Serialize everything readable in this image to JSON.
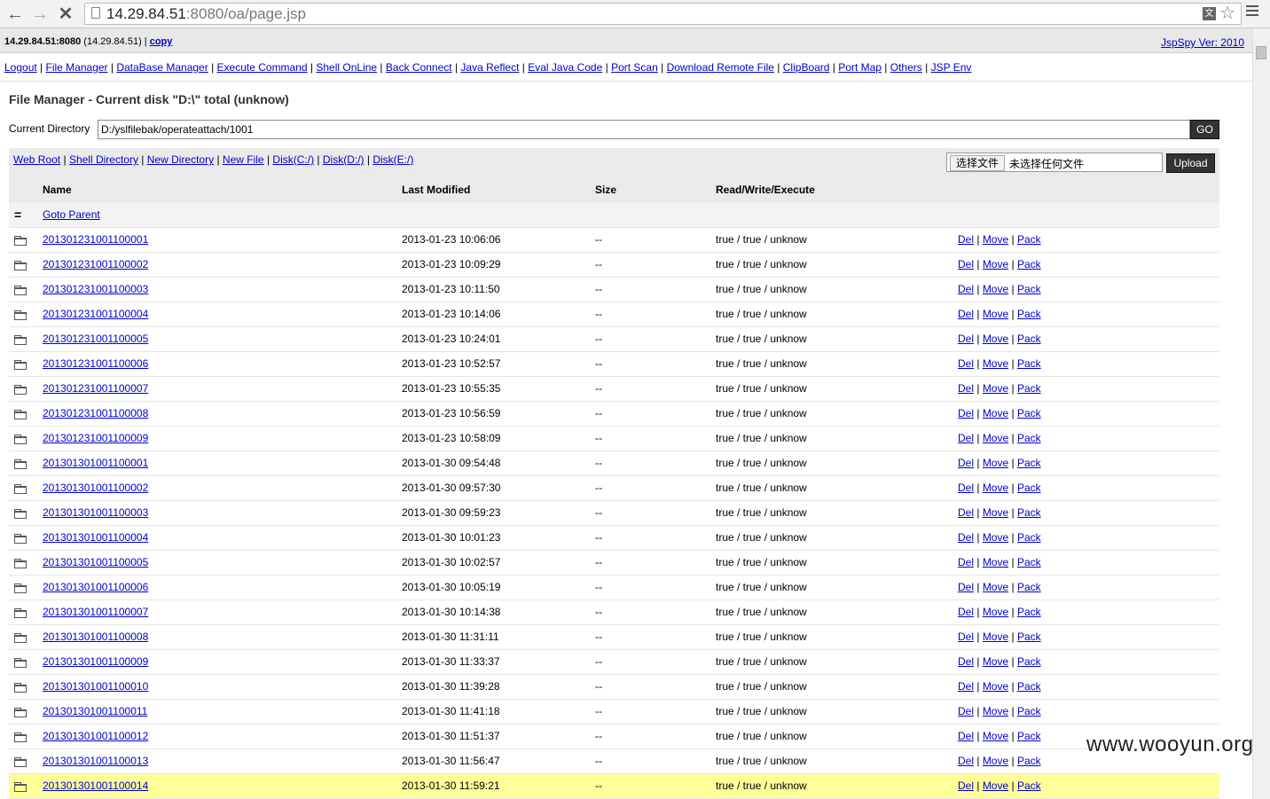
{
  "browser": {
    "url_host": "14.29.84.51",
    "url_rest": ":8080/oa/page.jsp"
  },
  "info": {
    "host_bold": "14.29.84.51:8080",
    "host_ip": " (14.29.84.51) | ",
    "copy_label": "copy",
    "version": "JspSpy Ver: 2010"
  },
  "nav": {
    "items": [
      "Logout",
      "File Manager",
      "DataBase Manager",
      "Execute Command",
      "Shell OnLine",
      "Back Connect",
      "Java Reflect",
      "Eval Java Code",
      "Port Scan",
      "Download Remote File",
      "ClipBoard",
      "Port Map",
      "Others",
      "JSP Env"
    ]
  },
  "fm": {
    "title": "File Manager - Current disk \"D:\\\" total (unknow)",
    "dir_label": "Current Directory",
    "dir_value": "D:/yslfilebak/operateattach/1001",
    "go_label": "GO"
  },
  "toolbar": {
    "links": [
      "Web Root",
      "Shell Directory",
      "New Directory",
      "New File",
      "Disk(C:/)",
      "Disk(D:/)",
      "Disk(E:/)"
    ],
    "choose_file": "选择文件",
    "no_file": "未选择任何文件",
    "upload_label": "Upload"
  },
  "table": {
    "headers": {
      "name": "Name",
      "modified": "Last Modified",
      "size": "Size",
      "rwx": "Read/Write/Execute"
    },
    "parent_label": "Goto Parent",
    "parent_icon": "=",
    "actions": [
      "Del",
      "Move",
      "Pack"
    ],
    "rows": [
      {
        "name": "201301231001100001",
        "modified": "2013-01-23 10:06:06",
        "size": "--",
        "rwx": "true / true / unknow"
      },
      {
        "name": "201301231001100002",
        "modified": "2013-01-23 10:09:29",
        "size": "--",
        "rwx": "true / true / unknow"
      },
      {
        "name": "201301231001100003",
        "modified": "2013-01-23 10:11:50",
        "size": "--",
        "rwx": "true / true / unknow"
      },
      {
        "name": "201301231001100004",
        "modified": "2013-01-23 10:14:06",
        "size": "--",
        "rwx": "true / true / unknow"
      },
      {
        "name": "201301231001100005",
        "modified": "2013-01-23 10:24:01",
        "size": "--",
        "rwx": "true / true / unknow"
      },
      {
        "name": "201301231001100006",
        "modified": "2013-01-23 10:52:57",
        "size": "--",
        "rwx": "true / true / unknow"
      },
      {
        "name": "201301231001100007",
        "modified": "2013-01-23 10:55:35",
        "size": "--",
        "rwx": "true / true / unknow"
      },
      {
        "name": "201301231001100008",
        "modified": "2013-01-23 10:56:59",
        "size": "--",
        "rwx": "true / true / unknow"
      },
      {
        "name": "201301231001100009",
        "modified": "2013-01-23 10:58:09",
        "size": "--",
        "rwx": "true / true / unknow"
      },
      {
        "name": "201301301001100001",
        "modified": "2013-01-30 09:54:48",
        "size": "--",
        "rwx": "true / true / unknow"
      },
      {
        "name": "201301301001100002",
        "modified": "2013-01-30 09:57:30",
        "size": "--",
        "rwx": "true / true / unknow"
      },
      {
        "name": "201301301001100003",
        "modified": "2013-01-30 09:59:23",
        "size": "--",
        "rwx": "true / true / unknow"
      },
      {
        "name": "201301301001100004",
        "modified": "2013-01-30 10:01:23",
        "size": "--",
        "rwx": "true / true / unknow"
      },
      {
        "name": "201301301001100005",
        "modified": "2013-01-30 10:02:57",
        "size": "--",
        "rwx": "true / true / unknow"
      },
      {
        "name": "201301301001100006",
        "modified": "2013-01-30 10:05:19",
        "size": "--",
        "rwx": "true / true / unknow"
      },
      {
        "name": "201301301001100007",
        "modified": "2013-01-30 10:14:38",
        "size": "--",
        "rwx": "true / true / unknow"
      },
      {
        "name": "201301301001100008",
        "modified": "2013-01-30 11:31:11",
        "size": "--",
        "rwx": "true / true / unknow"
      },
      {
        "name": "201301301001100009",
        "modified": "2013-01-30 11:33:37",
        "size": "--",
        "rwx": "true / true / unknow"
      },
      {
        "name": "201301301001100010",
        "modified": "2013-01-30 11:39:28",
        "size": "--",
        "rwx": "true / true / unknow"
      },
      {
        "name": "201301301001100011",
        "modified": "2013-01-30 11:41:18",
        "size": "--",
        "rwx": "true / true / unknow"
      },
      {
        "name": "201301301001100012",
        "modified": "2013-01-30 11:51:37",
        "size": "--",
        "rwx": "true / true / unknow"
      },
      {
        "name": "201301301001100013",
        "modified": "2013-01-30 11:56:47",
        "size": "--",
        "rwx": "true / true / unknow"
      },
      {
        "name": "201301301001100014",
        "modified": "2013-01-30 11:59:21",
        "size": "--",
        "rwx": "true / true / unknow",
        "highlight": true
      }
    ]
  },
  "colors": {
    "link": "#0000cc",
    "highlight_row": "#ffff99",
    "header_bg": "#eaeaea"
  },
  "icons": {
    "row_icon": "folder-icon",
    "back": "back-arrow-icon",
    "forward": "forward-arrow-icon",
    "stop": "stop-icon"
  },
  "watermark": "www.wooyun.org"
}
